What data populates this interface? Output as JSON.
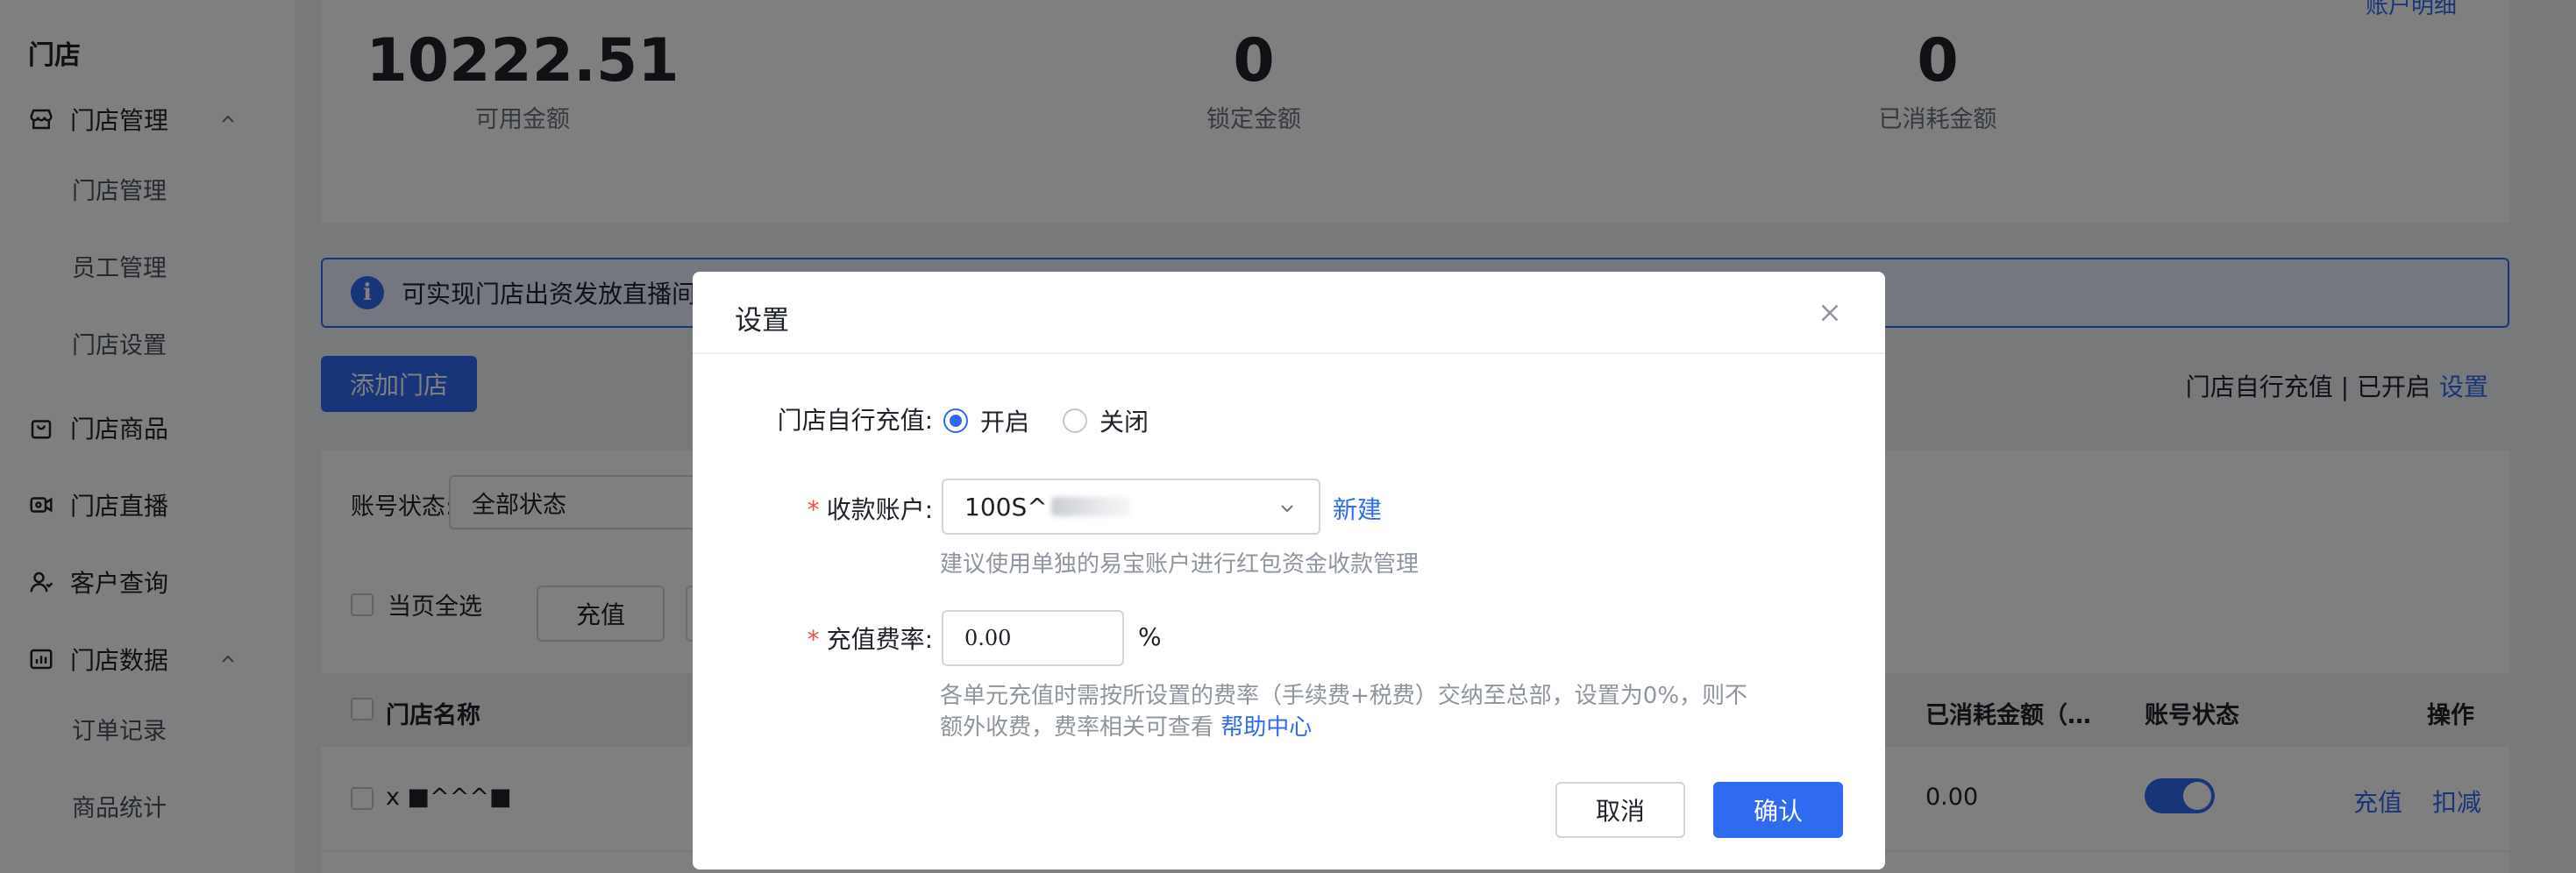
{
  "sidebar": {
    "title": "门店",
    "groups": [
      {
        "label": "门店管理",
        "icon": "store-icon",
        "expanded": true,
        "items": [
          "门店管理",
          "员工管理",
          "门店设置"
        ]
      },
      {
        "label": "门店商品",
        "icon": "shopping-bag-icon"
      },
      {
        "label": "门店直播",
        "icon": "live-camera-icon"
      },
      {
        "label": "客户查询",
        "icon": "user-icon"
      },
      {
        "label": "门店数据",
        "icon": "data-chart-icon",
        "expanded": true,
        "items": [
          "订单记录",
          "商品统计"
        ]
      }
    ]
  },
  "stats": {
    "top_link": "账户明细",
    "available": {
      "value": "10222.51",
      "label": "可用金额"
    },
    "locked": {
      "value": "0",
      "label": "锁定金额"
    },
    "consumed": {
      "value": "0",
      "label": "已消耗金额"
    }
  },
  "banner": {
    "text": "可实现门店出资发放直播间"
  },
  "toolbar": {
    "add_store": "添加门店",
    "recharge_status": "门店自行充值 | 已开启",
    "settings_link": "设置"
  },
  "filter": {
    "label": "账号状态:",
    "value": "全部状态"
  },
  "bulk": {
    "select_page": "当页全选",
    "recharge": "充值"
  },
  "table": {
    "headers": {
      "name": "门店名称",
      "consumed": "已消耗金额（…",
      "status": "账号状态",
      "actions": "操作"
    },
    "rows": [
      {
        "name": "x ■^^^■",
        "consumed": "0.00",
        "status_on": true,
        "action_recharge": "充值",
        "action_deduct": "扣减"
      }
    ]
  },
  "modal": {
    "title": "设置",
    "self_recharge": {
      "label": "门店自行充值:",
      "on": "开启",
      "off": "关闭",
      "selected": "on"
    },
    "account": {
      "label": "收款账户:",
      "value": "100S^",
      "new_link": "新建",
      "hint": "建议使用单独的易宝账户进行红包资金收款管理"
    },
    "rate": {
      "label": "充值费率:",
      "placeholder": "0.00",
      "unit": "%",
      "hint_line1": "各单元充值时需按所设置的费率（手续费+税费）交纳至总部，设置为0%，则不",
      "hint_line2": "额外收费，费率相关可查看",
      "help_link": "帮助中心"
    },
    "cancel": "取消",
    "confirm": "确认"
  }
}
